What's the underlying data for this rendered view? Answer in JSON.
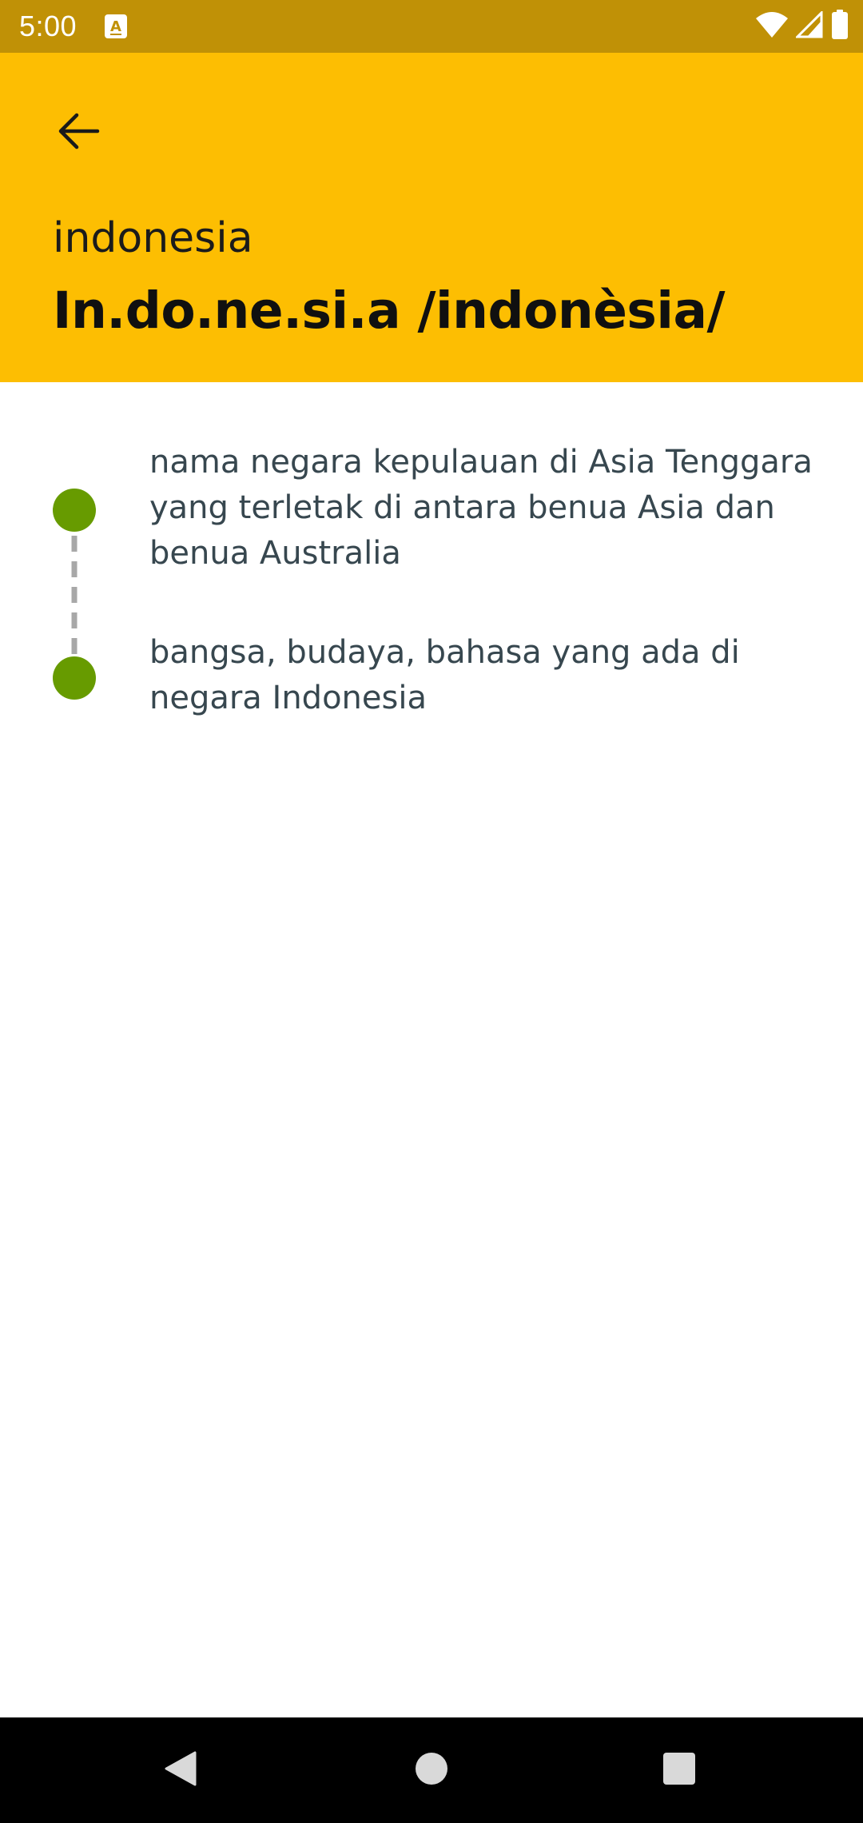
{
  "status_bar": {
    "time": "5:00",
    "icons": [
      "notification-a-icon",
      "wifi-icon",
      "signal-icon",
      "battery-icon"
    ]
  },
  "header": {
    "back_icon": "arrow-left-icon",
    "word": "indonesia",
    "syllable_pronunciation": "In.do.ne.si.a /indonèsia/",
    "background_color": "#fdbe02"
  },
  "definitions": [
    {
      "text": "nama negara kepulauan di Asia Tenggara yang terletak di antara benua Asia dan benua Australia"
    },
    {
      "text": "bangsa, budaya, bahasa yang ada di negara Indonesia"
    }
  ],
  "timeline": {
    "dot_color": "#679b00",
    "connector_color": "#a8a8a8"
  },
  "navigation_bar": {
    "buttons": [
      "back-triangle-icon",
      "home-circle-icon",
      "recents-square-icon"
    ]
  }
}
